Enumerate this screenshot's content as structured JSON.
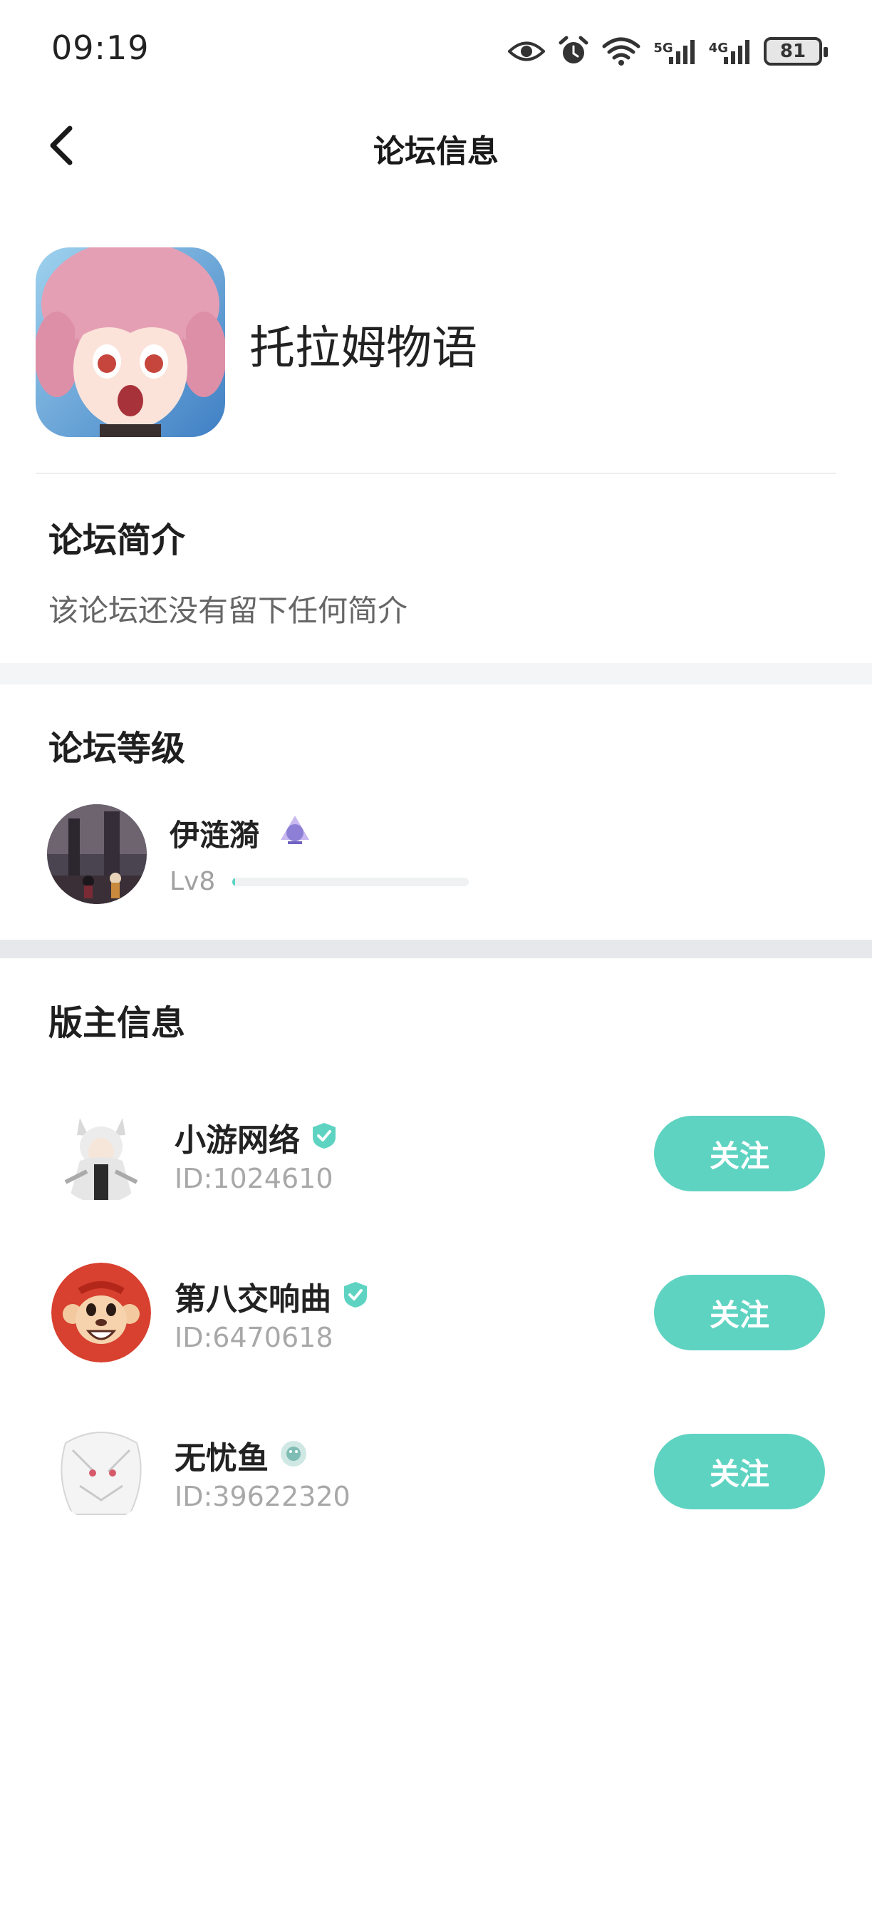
{
  "status_bar": {
    "time": "09:19",
    "network_5g": "5G",
    "network_4g": "4G",
    "battery": "81",
    "icons": [
      "eye-icon",
      "alarm-icon",
      "wifi-icon",
      "signal-5g-icon",
      "signal-4g-icon",
      "battery-icon"
    ]
  },
  "nav": {
    "title": "论坛信息",
    "back_icon": "chevron-left-icon"
  },
  "forum": {
    "name": "托拉姆物语"
  },
  "intro": {
    "title": "论坛简介",
    "text": "该论坛还没有留下任何简介"
  },
  "level": {
    "title": "论坛等级",
    "user_name": "伊涟漪",
    "level_label": "Lv8",
    "progress": 0.01,
    "accent_color": "#5fd3c2"
  },
  "moderators": {
    "title": "版主信息",
    "follow_label": "关注",
    "items": [
      {
        "name": "小游网络",
        "id": "ID:1024610",
        "badge": "verified-icon"
      },
      {
        "name": "第八交响曲",
        "id": "ID:6470618",
        "badge": "verified-icon"
      },
      {
        "name": "无忧鱼",
        "id": "ID:39622320",
        "badge": "medal-icon"
      }
    ]
  },
  "colors": {
    "accent": "#5fd3c2",
    "section_gap": "#f4f5f7",
    "muted_text": "#a8a8a8"
  }
}
